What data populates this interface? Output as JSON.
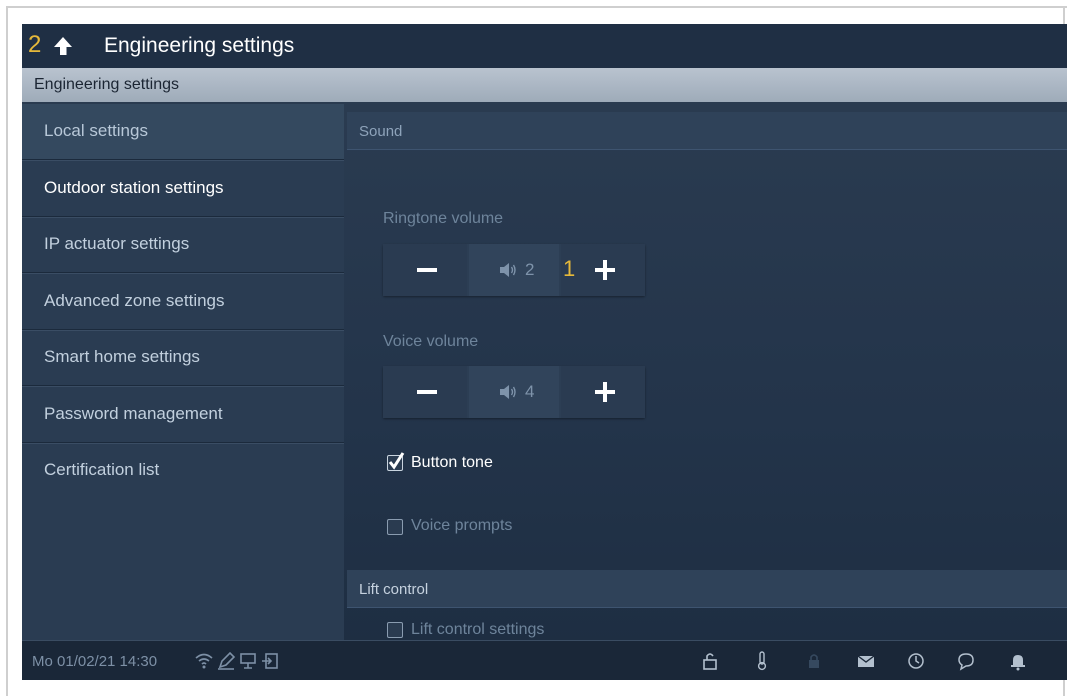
{
  "header": {
    "step_number": "2",
    "title": "Engineering settings"
  },
  "section_header": "Engineering settings",
  "sidebar": {
    "items": [
      {
        "label": "Local settings",
        "active": true
      },
      {
        "label": "Outdoor station settings",
        "highlight": true
      },
      {
        "label": "IP actuator settings"
      },
      {
        "label": "Advanced zone settings"
      },
      {
        "label": "Smart home settings"
      },
      {
        "label": "Password management"
      },
      {
        "label": "Certification list"
      }
    ]
  },
  "content": {
    "sound_group": "Sound",
    "ringtone": {
      "label": "Ringtone volume",
      "value": "2",
      "annotation": "1"
    },
    "voice": {
      "label": "Voice volume",
      "value": "4"
    },
    "button_tone": {
      "label": "Button tone",
      "checked": true
    },
    "voice_prompts": {
      "label": "Voice prompts",
      "checked": false
    },
    "lift_group": "Lift control",
    "lift_settings": {
      "label": "Lift control settings",
      "checked": false
    }
  },
  "statusbar": {
    "datetime": "Mo 01/02/21  14:30",
    "icons": [
      "wifi-icon",
      "pen-icon",
      "monitor-icon",
      "exit-icon",
      "unlock-icon",
      "thermometer-icon",
      "lock-icon",
      "mail-icon",
      "history-icon",
      "chat-icon",
      "bell-icon"
    ]
  },
  "colors": {
    "accent": "#e6b93a",
    "background": "#23344a",
    "header_bar": "#a9b5c3"
  }
}
